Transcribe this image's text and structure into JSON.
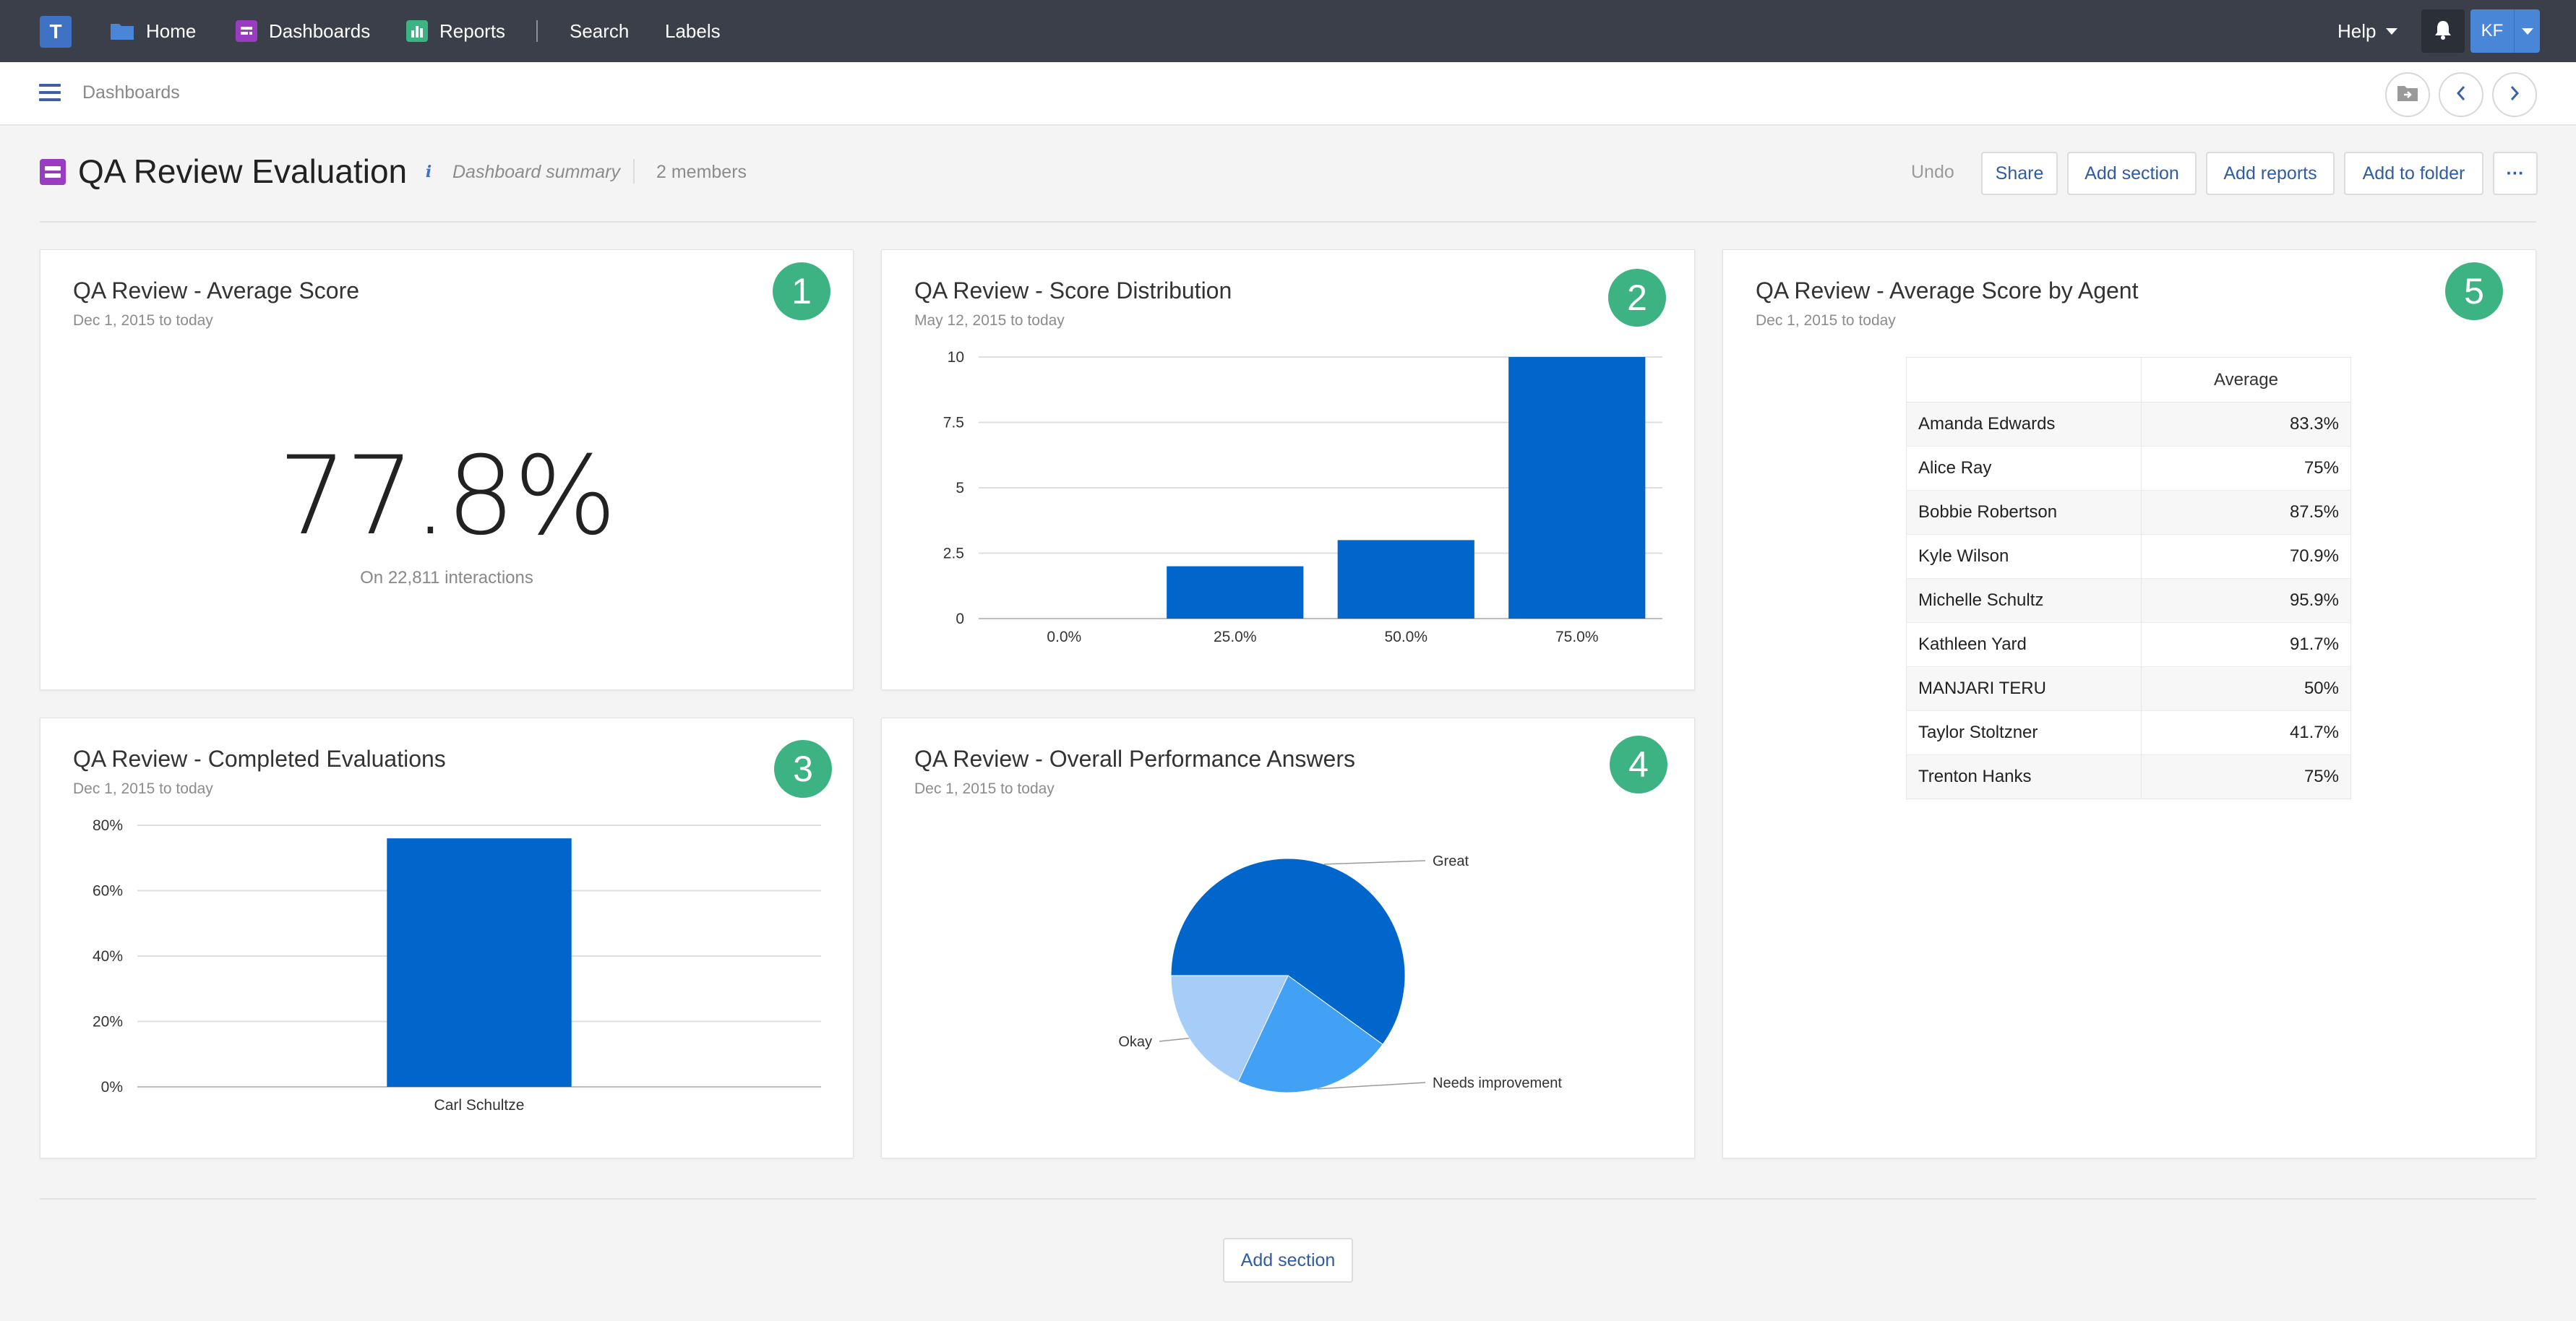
{
  "nav": {
    "logo_letter": "T",
    "home": "Home",
    "dashboards": "Dashboards",
    "reports": "Reports",
    "search": "Search",
    "labels": "Labels",
    "help": "Help",
    "user_initials": "KF"
  },
  "breadcrumb": "Dashboards",
  "dashboard": {
    "title": "QA Review Evaluation",
    "summary": "Dashboard summary",
    "members": "2 members",
    "undo": "Undo",
    "share": "Share",
    "add_section": "Add section",
    "add_reports": "Add reports",
    "add_to_folder": "Add to folder",
    "more": "···"
  },
  "cards": {
    "avg_score": {
      "badge": "1",
      "title": "QA Review - Average Score",
      "subtitle": "Dec 1, 2015 to today",
      "value": "77.8%",
      "caption": "On 22,811 interactions"
    },
    "score_dist": {
      "badge": "2",
      "title": "QA Review - Score Distribution",
      "subtitle": "May 12, 2015 to today"
    },
    "completed": {
      "badge": "3",
      "title": "QA Review - Completed Evaluations",
      "subtitle": "Dec 1, 2015 to today"
    },
    "overall": {
      "badge": "4",
      "title": "QA Review - Overall Performance Answers",
      "subtitle": "Dec 1, 2015 to today"
    },
    "by_agent": {
      "badge": "5",
      "title": "QA Review - Average Score by Agent",
      "subtitle": "Dec 1, 2015 to today",
      "column_header": "Average",
      "rows": [
        {
          "name": "Amanda Edwards",
          "avg": "83.3%"
        },
        {
          "name": "Alice Ray",
          "avg": "75%"
        },
        {
          "name": "Bobbie Robertson",
          "avg": "87.5%"
        },
        {
          "name": "Kyle Wilson",
          "avg": "70.9%"
        },
        {
          "name": "Michelle Schultz",
          "avg": "95.9%"
        },
        {
          "name": "Kathleen Yard",
          "avg": "91.7%"
        },
        {
          "name": "MANJARI TERU",
          "avg": "50%"
        },
        {
          "name": "Taylor Stoltzner",
          "avg": "41.7%"
        },
        {
          "name": "Trenton Hanks",
          "avg": "75%"
        }
      ]
    }
  },
  "bottom": {
    "add_section": "Add section"
  },
  "colors": {
    "accent": "#0066cc",
    "badge": "#3db383",
    "nav_bg": "#3a3f4a"
  },
  "chart_data": [
    {
      "type": "bar",
      "title": "QA Review - Score Distribution",
      "categories": [
        "0.0%",
        "25.0%",
        "50.0%",
        "75.0%"
      ],
      "values": [
        0,
        2,
        3,
        10
      ],
      "ylim": [
        0,
        10
      ],
      "yticks": [
        "0",
        "2.5",
        "5",
        "7.5",
        "10"
      ],
      "grid": true
    },
    {
      "type": "bar",
      "title": "QA Review - Completed Evaluations",
      "categories": [
        "Carl Schultze"
      ],
      "values": [
        76
      ],
      "ylim": [
        0,
        80
      ],
      "yticks": [
        "0%",
        "20%",
        "40%",
        "60%",
        "80%"
      ],
      "grid": true
    },
    {
      "type": "pie",
      "title": "QA Review - Overall Performance Answers",
      "labels": [
        "Great",
        "Needs improvement",
        "Okay"
      ],
      "values": [
        60,
        22,
        18
      ],
      "colors": [
        "#0066cc",
        "#42a0f5",
        "#a6cdf7"
      ]
    }
  ]
}
